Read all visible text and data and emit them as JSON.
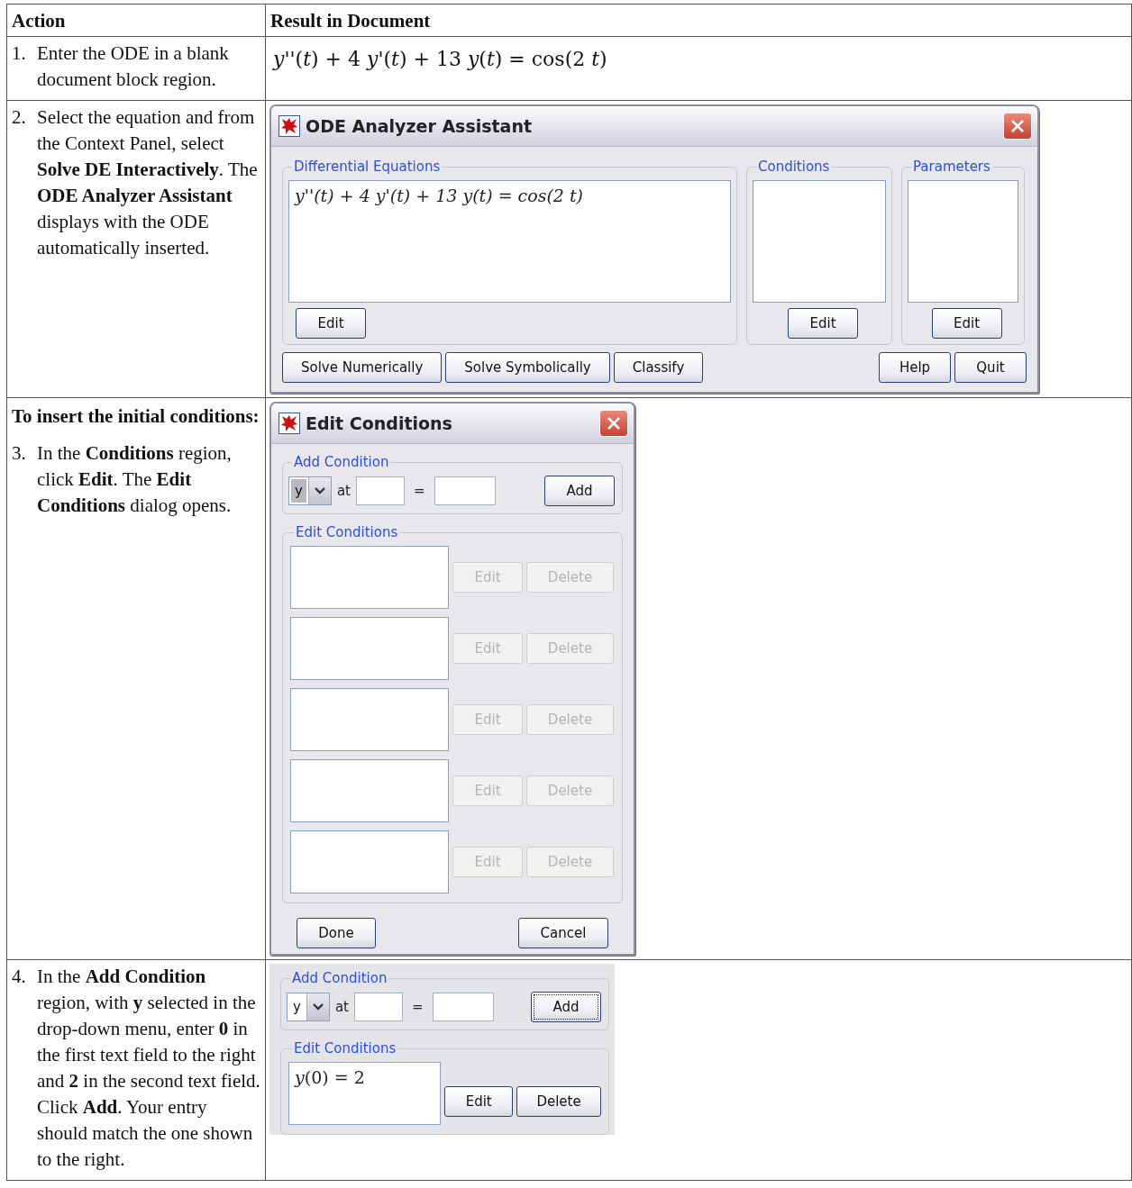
{
  "table": {
    "columns": [
      "Action",
      "Result in Document"
    ],
    "rows": [
      {
        "action": {
          "number": "1.",
          "text": "Enter the ODE in a blank document block region."
        },
        "result": {
          "kind": "math",
          "math": "*y*''(*t*) + 4 *y*'(*t*) + 13 *y*(*t*) = cos(2 *t*)"
        }
      },
      {
        "action": {
          "number": "2.",
          "text": "Select the equation and from the Context Panel, select **Solve DE Interactively**. The **ODE Analyzer Assistant** displays with the ODE automatically inserted."
        },
        "result": {
          "kind": "ode_dialog",
          "title": "ODE Analyzer Assistant",
          "groups": [
            {
              "legend": "Differential Equations",
              "content": "y''(t) + 4 y'(t) + 13 y(t) = cos(2 t)",
              "button": "Edit"
            },
            {
              "legend": "Conditions",
              "button": "Edit"
            },
            {
              "legend": "Parameters",
              "button": "Edit"
            }
          ],
          "buttons_left": [
            "Solve Numerically",
            "Solve Symbolically",
            "Classify"
          ],
          "buttons_right": [
            "Help",
            "Quit"
          ]
        }
      },
      {
        "action": {
          "heading": "To insert the initial conditions:",
          "number": "3.",
          "text": "In the **Conditions** region, click **Edit**. The **Edit Conditions** dialog opens."
        },
        "result": {
          "kind": "conditions_dialog",
          "title": "Edit Conditions",
          "add_condition": {
            "legend": "Add Condition",
            "dropdown_value": "y",
            "highlighted": true,
            "at_label": "at",
            "equals": "=",
            "button": "Add",
            "focused": false
          },
          "edit_conditions": {
            "legend": "Edit Conditions",
            "entries": [
              {
                "edit": "Edit",
                "delete": "Delete",
                "disabled": true
              },
              {
                "edit": "Edit",
                "delete": "Delete",
                "disabled": true
              },
              {
                "edit": "Edit",
                "delete": "Delete",
                "disabled": true
              },
              {
                "edit": "Edit",
                "delete": "Delete",
                "disabled": true
              },
              {
                "edit": "Edit",
                "delete": "Delete",
                "disabled": true
              }
            ]
          },
          "buttons": [
            "Done",
            "Cancel"
          ]
        }
      },
      {
        "action": {
          "number": "4.",
          "text": "In the **Add Condition** region, with **y** selected in the drop-down menu, enter **0** in the first text field to the right and **2** in the second text field. Click **Add**. Your entry should match the one shown to the right."
        },
        "result": {
          "kind": "conditions_panel",
          "add_condition": {
            "legend": "Add Condition",
            "dropdown_value": "y",
            "highlighted": false,
            "at_label": "at",
            "equals": "=",
            "button": "Add",
            "focused": true
          },
          "edit_conditions": {
            "legend": "Edit Conditions",
            "entries": [
              {
                "content": "*y*(0) = 2",
                "edit": "Edit",
                "delete": "Delete",
                "disabled": false
              }
            ]
          }
        }
      }
    ]
  }
}
